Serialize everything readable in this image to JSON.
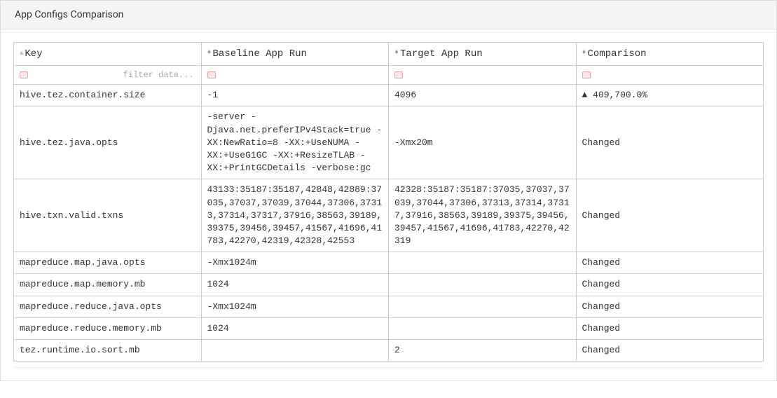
{
  "panel": {
    "title": "App Configs Comparison"
  },
  "table": {
    "headers": {
      "key": "Key",
      "baseline": "Baseline App Run",
      "target": "Target App Run",
      "comparison": "Comparison"
    },
    "filter": {
      "placeholder": "filter data..."
    },
    "rows": [
      {
        "key": "hive.tez.container.size",
        "baseline": "-1",
        "target": "4096",
        "comparison": "▲ 409,700.0%"
      },
      {
        "key": "hive.tez.java.opts",
        "baseline": "-server -Djava.net.preferIPv4Stack=true -XX:NewRatio=8 -XX:+UseNUMA -XX:+UseG1GC -XX:+ResizeTLAB -XX:+PrintGCDetails -verbose:gc",
        "target": "-Xmx20m",
        "comparison": "Changed"
      },
      {
        "key": "hive.txn.valid.txns",
        "baseline": "43133:35187:35187,42848,42889:37035,37037,37039,37044,37306,37313,37314,37317,37916,38563,39189,39375,39456,39457,41567,41696,41783,42270,42319,42328,42553",
        "target": "42328:35187:35187:37035,37037,37039,37044,37306,37313,37314,37317,37916,38563,39189,39375,39456,39457,41567,41696,41783,42270,42319",
        "comparison": "Changed"
      },
      {
        "key": "mapreduce.map.java.opts",
        "baseline": "-Xmx1024m",
        "target": "",
        "comparison": "Changed"
      },
      {
        "key": "mapreduce.map.memory.mb",
        "baseline": "1024",
        "target": "",
        "comparison": "Changed"
      },
      {
        "key": "mapreduce.reduce.java.opts",
        "baseline": "-Xmx1024m",
        "target": "",
        "comparison": "Changed"
      },
      {
        "key": "mapreduce.reduce.memory.mb",
        "baseline": "1024",
        "target": "",
        "comparison": "Changed"
      },
      {
        "key": "tez.runtime.io.sort.mb",
        "baseline": "",
        "target": "2",
        "comparison": "Changed"
      }
    ]
  }
}
